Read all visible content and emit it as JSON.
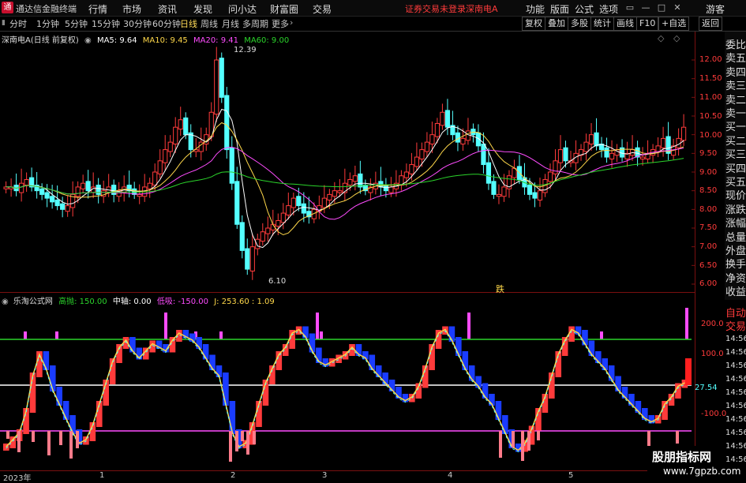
{
  "app": {
    "title": "通达信金融终端"
  },
  "menu": [
    "行情",
    "市场",
    "资讯",
    "发现",
    "问小达",
    "财富圈",
    "交易"
  ],
  "status": {
    "text": "证券交易未登录",
    "stock": "深南电A"
  },
  "menu_right": [
    "功能",
    "版面",
    "公式",
    "选项"
  ],
  "visitor": "游客",
  "periods": [
    "分时",
    "1分钟",
    "5分钟",
    "15分钟",
    "30分钟",
    "60分钟",
    "日线",
    "周线",
    "月线",
    "多周期",
    "更多"
  ],
  "active_period": "日线",
  "toolbar_right": [
    "复权",
    "叠加",
    "多股",
    "统计",
    "画线",
    "F10",
    "+自选",
    "返回"
  ],
  "chart_info": {
    "name": "深南电A(日线 前复权)",
    "ma5": "MA5: 9.64",
    "ma10": "MA10: 9.45",
    "ma20": "MA20: 9.41",
    "ma60": "MA60: 9.00",
    "high_label": "12.39",
    "low_label": "6.10",
    "fall_marker": "跌"
  },
  "sub_info": {
    "name": "乐淘公式网",
    "high": "高抛: 150.00",
    "mid": "中轴: 0.00",
    "low": "低吸: -150.00",
    "j": "J: 253.60",
    "v": ": 1.09"
  },
  "price_axis": [
    "12.00",
    "11.50",
    "11.00",
    "10.50",
    "10.00",
    "9.50",
    "9.00",
    "8.50",
    "8.00",
    "7.50",
    "7.00",
    "6.50",
    "6.00"
  ],
  "sub_axis": [
    "200.0",
    "100.0",
    "27.54",
    "-100.0"
  ],
  "side_items": [
    "委比",
    "卖五",
    "卖四",
    "卖三",
    "卖二",
    "卖一",
    "买一",
    "买二",
    "买三",
    "买四",
    "买五",
    "现价",
    "涨跌",
    "涨幅",
    "总量",
    "外盘",
    "换手",
    "净资",
    "收益",
    "自动",
    "交易"
  ],
  "times": [
    "14:56",
    "14:56",
    "14:56",
    "14:56",
    "14:56",
    "14:56",
    "14:56",
    "14:56",
    "14:56",
    "14:56"
  ],
  "dates": [
    "2023年",
    "1",
    "2",
    "3",
    "4",
    "5"
  ],
  "watermark": {
    "line1": "股朋指标网",
    "line2": "www.7gpzb.com"
  },
  "colors": {
    "up": "#ff3b3b",
    "down": "#54ffff",
    "ma5": "#ffffff",
    "ma10": "#ffd84a",
    "ma20": "#ff4cff",
    "ma60": "#2bd42b",
    "axis_line": "#7a1010"
  }
}
